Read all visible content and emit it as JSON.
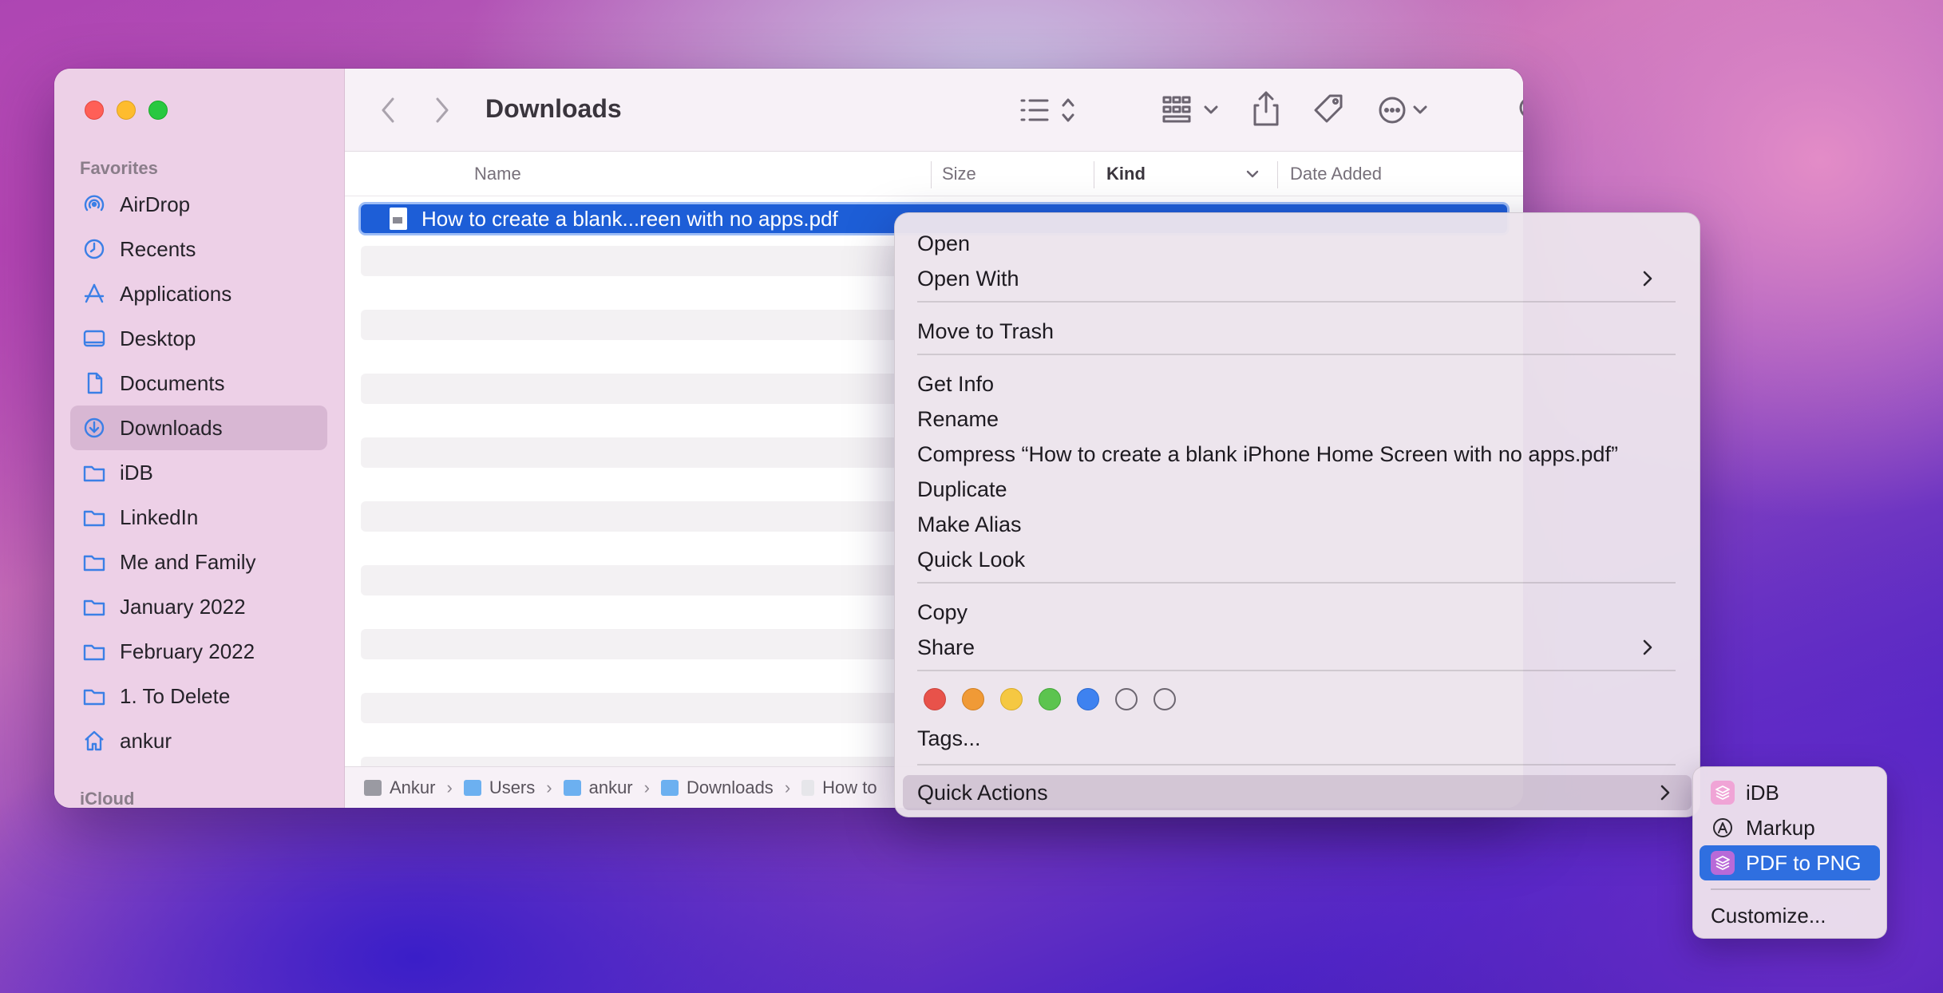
{
  "window": {
    "title": "Downloads"
  },
  "sidebar": {
    "favorites_header": "Favorites",
    "icloud_header": "iCloud",
    "items": [
      {
        "label": "AirDrop",
        "icon": "airdrop-icon"
      },
      {
        "label": "Recents",
        "icon": "clock-icon"
      },
      {
        "label": "Applications",
        "icon": "applications-icon"
      },
      {
        "label": "Desktop",
        "icon": "desktop-icon"
      },
      {
        "label": "Documents",
        "icon": "document-icon"
      },
      {
        "label": "Downloads",
        "icon": "download-icon",
        "selected": true
      },
      {
        "label": "iDB",
        "icon": "folder-icon"
      },
      {
        "label": "LinkedIn",
        "icon": "folder-icon"
      },
      {
        "label": "Me and Family",
        "icon": "folder-icon"
      },
      {
        "label": "January 2022",
        "icon": "folder-icon"
      },
      {
        "label": "February 2022",
        "icon": "folder-icon"
      },
      {
        "label": "1. To Delete",
        "icon": "folder-icon"
      },
      {
        "label": "ankur",
        "icon": "home-icon"
      }
    ]
  },
  "columns": {
    "name": "Name",
    "size": "Size",
    "kind": "Kind",
    "date_added": "Date Added"
  },
  "file": {
    "name": "How to create a blank...reen with no apps.pdf"
  },
  "pathbar": {
    "items": [
      "Ankur",
      "Users",
      "ankur",
      "Downloads",
      "How to"
    ],
    "separator": "›"
  },
  "context_menu": {
    "open": "Open",
    "open_with": "Open With",
    "move_to_trash": "Move to Trash",
    "get_info": "Get Info",
    "rename": "Rename",
    "compress": "Compress “How to create a blank iPhone Home Screen with no apps.pdf”",
    "duplicate": "Duplicate",
    "make_alias": "Make Alias",
    "quick_look": "Quick Look",
    "copy": "Copy",
    "share": "Share",
    "tags": "Tags...",
    "quick_actions": "Quick Actions",
    "tag_colors": [
      "#e8524a",
      "#f09a36",
      "#f5c842",
      "#5cc44f",
      "#3e82f0",
      "none",
      "none"
    ]
  },
  "quick_actions_submenu": {
    "items": [
      "iDB",
      "Markup",
      "PDF to PNG"
    ],
    "customize": "Customize...",
    "highlighted": "PDF to PNG"
  },
  "colors": {
    "accent": "#1d5ed7",
    "highlight": "#2f6fe0"
  }
}
